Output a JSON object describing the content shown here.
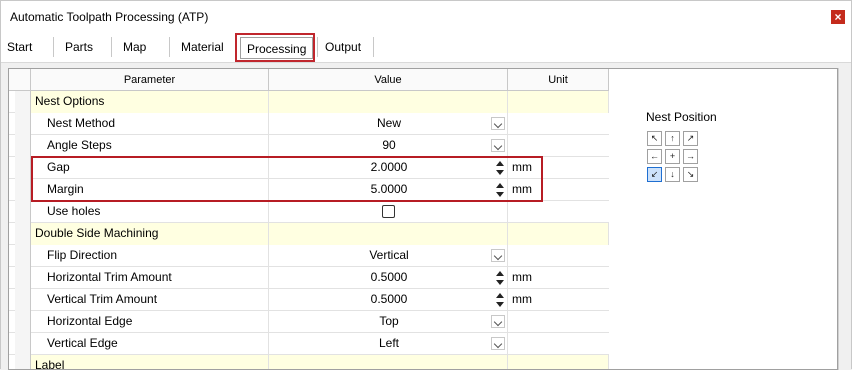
{
  "window": {
    "title": "Automatic Toolpath Processing (ATP)",
    "close_glyph": "×"
  },
  "tabs": [
    {
      "label": "Start"
    },
    {
      "label": "Parts"
    },
    {
      "label": "Map"
    },
    {
      "label": "Material"
    },
    {
      "label": "Processing"
    },
    {
      "label": "Output"
    }
  ],
  "active_tab": "Processing",
  "grid": {
    "headers": {
      "parameter": "Parameter",
      "value": "Value",
      "unit": "Unit"
    },
    "rows": [
      {
        "type": "category",
        "label": "Nest Options"
      },
      {
        "type": "dropdown",
        "label": "Nest Method",
        "value": "New",
        "unit": ""
      },
      {
        "type": "dropdown",
        "label": "Angle Steps",
        "value": "90",
        "unit": ""
      },
      {
        "type": "spin",
        "label": "Gap",
        "value": "2.0000",
        "unit": "mm"
      },
      {
        "type": "spin",
        "label": "Margin",
        "value": "5.0000",
        "unit": "mm"
      },
      {
        "type": "checkbox",
        "label": "Use holes",
        "value": false,
        "unit": ""
      },
      {
        "type": "category",
        "label": "Double Side Machining"
      },
      {
        "type": "dropdown",
        "label": "Flip Direction",
        "value": "Vertical",
        "unit": ""
      },
      {
        "type": "spin",
        "label": "Horizontal Trim Amount",
        "value": "0.5000",
        "unit": "mm"
      },
      {
        "type": "spin",
        "label": "Vertical Trim Amount",
        "value": "0.5000",
        "unit": "mm"
      },
      {
        "type": "dropdown",
        "label": "Horizontal Edge",
        "value": "Top",
        "unit": ""
      },
      {
        "type": "dropdown",
        "label": "Vertical Edge",
        "value": "Left",
        "unit": ""
      },
      {
        "type": "category",
        "label": "Label"
      }
    ]
  },
  "nest_position": {
    "label": "Nest Position",
    "buttons": [
      {
        "name": "top-left",
        "glyph": "↖"
      },
      {
        "name": "top-center",
        "glyph": "↑"
      },
      {
        "name": "top-right",
        "glyph": "↗"
      },
      {
        "name": "middle-left",
        "glyph": "←"
      },
      {
        "name": "center",
        "glyph": "+"
      },
      {
        "name": "middle-right",
        "glyph": "→"
      },
      {
        "name": "bottom-left",
        "glyph": "↙"
      },
      {
        "name": "bottom-center",
        "glyph": "↓"
      },
      {
        "name": "bottom-right",
        "glyph": "↘"
      }
    ],
    "selected": "bottom-left"
  },
  "colors": {
    "highlight": "#c0262d",
    "category_bg": "#ffffe1",
    "selected_border": "#1f6fd1"
  }
}
